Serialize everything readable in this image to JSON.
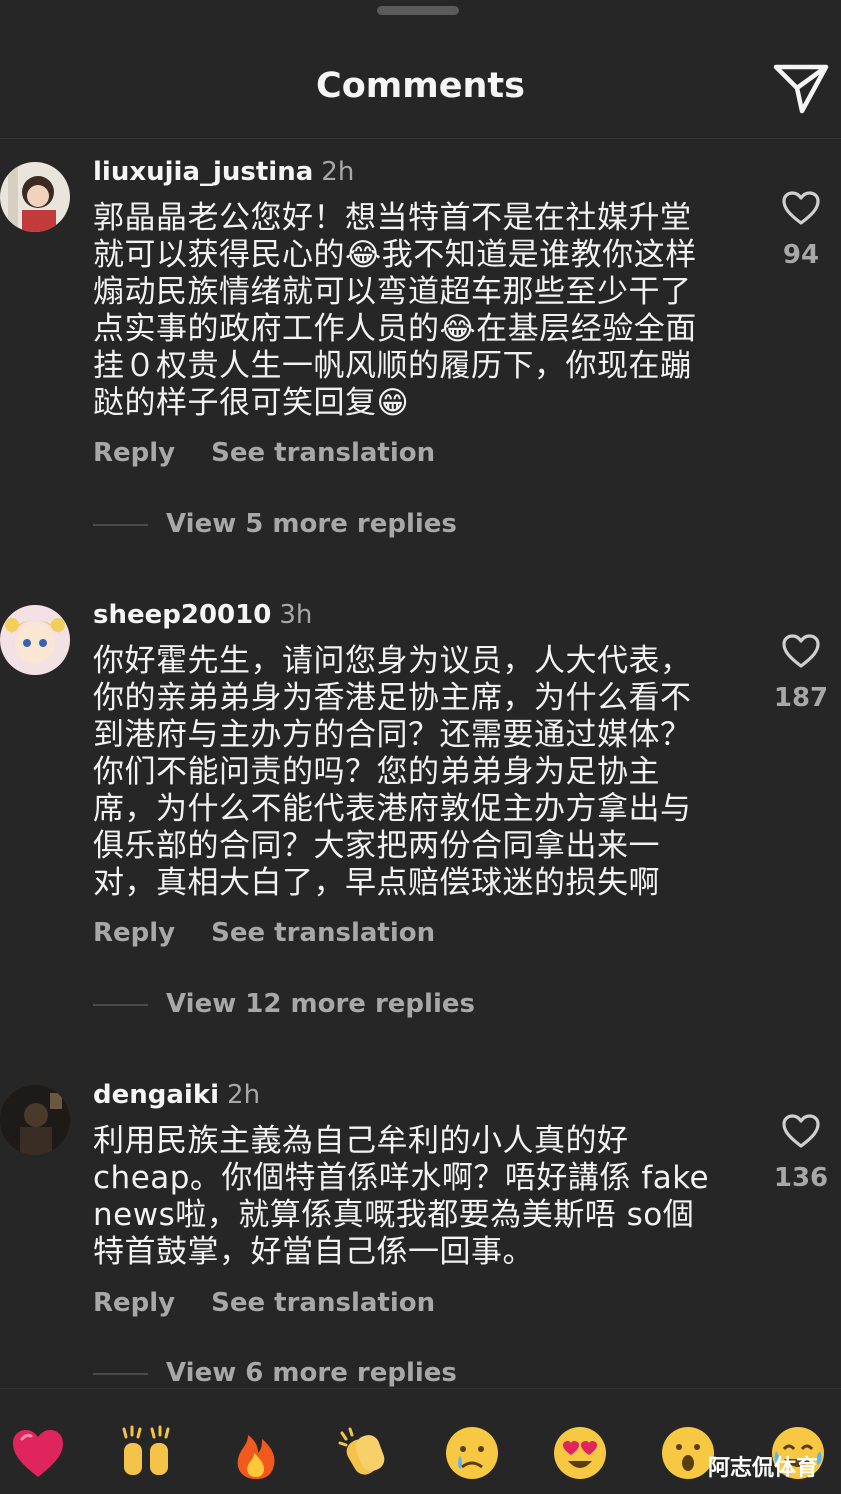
{
  "header": {
    "title": "Comments"
  },
  "comments": [
    {
      "username": "liuxujia_justina",
      "time": "2h",
      "text": "郭晶晶老公您好！想当特首不是在社媒升堂\n就可以获得民心的😂我不知道是谁教你这样\n煽动民族情绪就可以弯道超车那些至少干了\n点实事的政府工作人员的😂在基层经验全面\n挂０权贵人生一帆风顺的履历下，你现在蹦\n跶的样子很可笑回复😁",
      "reply_label": "Reply",
      "translate_label": "See translation",
      "view_more": "View 5 more replies",
      "likes": "94"
    },
    {
      "username": "sheep20010",
      "time": "3h",
      "text": "你好霍先生，请问您身为议员，人大代表，\n你的亲弟弟身为香港足协主席，为什么看不\n到港府与主办方的合同？还需要通过媒体？\n你们不能问责的吗？您的弟弟身为足协主\n席，为什么不能代表港府敦促主办方拿出与\n俱乐部的合同？大家把两份合同拿出来一\n对，真相大白了，早点赔偿球迷的损失啊",
      "reply_label": "Reply",
      "translate_label": "See translation",
      "view_more": "View 12 more replies",
      "likes": "187"
    },
    {
      "username": "dengaiki",
      "time": "2h",
      "text": "利用民族主義為自己牟利的小人真的好\ncheap。你個特首係咩水啊？唔好講係 fake\nnews啦，就算係真嘅我都要為美斯唔 so個\n特首鼓掌，好當自己係一回事。",
      "reply_label": "Reply",
      "translate_label": "See translation",
      "view_more": "View 6 more replies",
      "likes": "136"
    }
  ],
  "reactions": [
    "❤️",
    "🙌",
    "🔥",
    "👏",
    "😢",
    "😍",
    "😮",
    "😂"
  ],
  "watermark": "阿志侃体育",
  "colors": {
    "background": "#262626",
    "text": "#f5f5f5",
    "secondary": "#a8a8a8"
  }
}
